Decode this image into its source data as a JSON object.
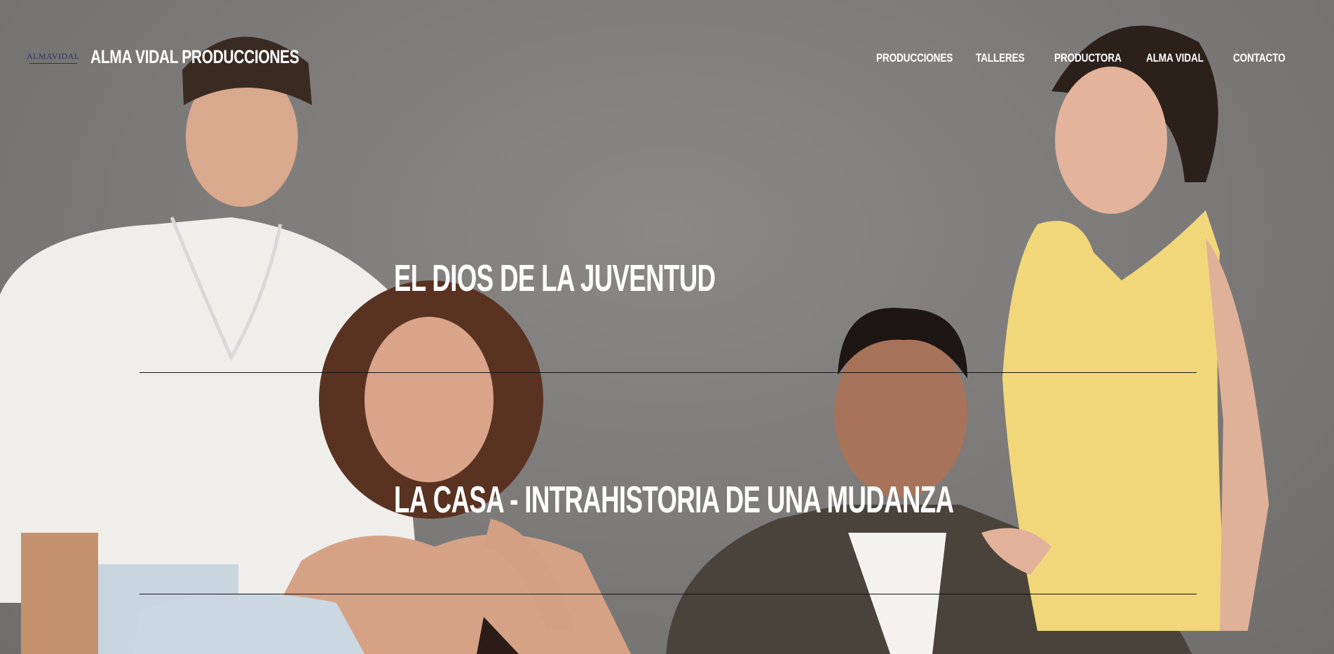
{
  "header": {
    "logo_text": "ALMAVIDAL",
    "brand": "ALMA VIDAL PRODUCCIONES"
  },
  "nav": {
    "items": [
      {
        "label": "PRODUCCIONES"
      },
      {
        "label": "TALLERES"
      },
      {
        "label": "PRODUCTORA"
      },
      {
        "label": "ALMA VIDAL"
      },
      {
        "label": "CONTACTO"
      }
    ]
  },
  "hero": {
    "image_alt": "Cast photo of four actors against a grey backdrop"
  },
  "productions": [
    {
      "title": "EL DIOS DE LA JUVENTUD"
    },
    {
      "title": "LA CASA - INTRAHISTORIA DE UNA MUDANZA"
    }
  ],
  "colors": {
    "background": "#7f7d7b",
    "text": "#ffffff",
    "rule": "#151515",
    "logo": "#2a3560"
  }
}
